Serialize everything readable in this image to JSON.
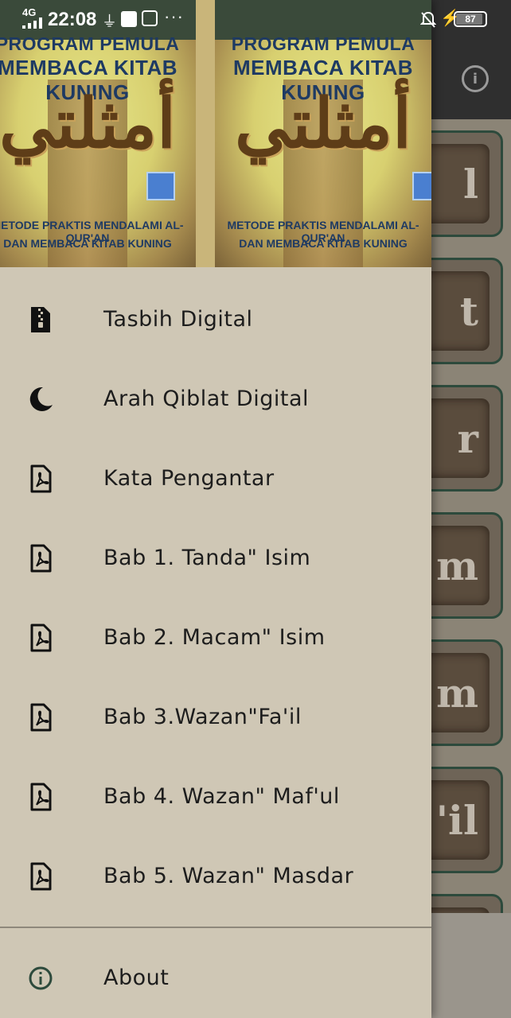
{
  "status_bar": {
    "network": "4G",
    "time": "22:08",
    "battery": "87",
    "battery_level_percent": 87
  },
  "header_image": {
    "title_line1": "PROGRAM PEMULA",
    "title_line2": "MEMBACA KITAB KUNING",
    "arabic_title": "أمثلتي",
    "subtitle_line1": "METODE PRAKTIS MENDALAMI AL-QUR'AN",
    "subtitle_line2": "DAN MEMBACA KITAB KUNING"
  },
  "menu": {
    "items": [
      {
        "label": "Tasbih Digital",
        "icon": "zip-file-icon"
      },
      {
        "label": "Arah Qiblat Digital",
        "icon": "moon-icon"
      },
      {
        "label": "Kata Pengantar",
        "icon": "pdf-file-icon"
      },
      {
        "label": "Bab 1. Tanda\" Isim",
        "icon": "pdf-file-icon"
      },
      {
        "label": "Bab 2. Macam\" Isim",
        "icon": "pdf-file-icon"
      },
      {
        "label": "Bab 3.Wazan\"Fa'il",
        "icon": "pdf-file-icon"
      },
      {
        "label": "Bab 4. Wazan\" Maf'ul",
        "icon": "pdf-file-icon"
      },
      {
        "label": "Bab 5. Wazan\" Masdar",
        "icon": "pdf-file-icon"
      }
    ],
    "about_label": "About",
    "about_icon": "info-icon"
  },
  "background": {
    "info_icon": "i",
    "card_letters": [
      "l",
      "t",
      "r",
      "m",
      "m",
      "'il"
    ]
  },
  "colors": {
    "drawer_bg": "#cfc7b5",
    "about_icon": "#2d4a3c",
    "text": "#1d1d1d"
  }
}
